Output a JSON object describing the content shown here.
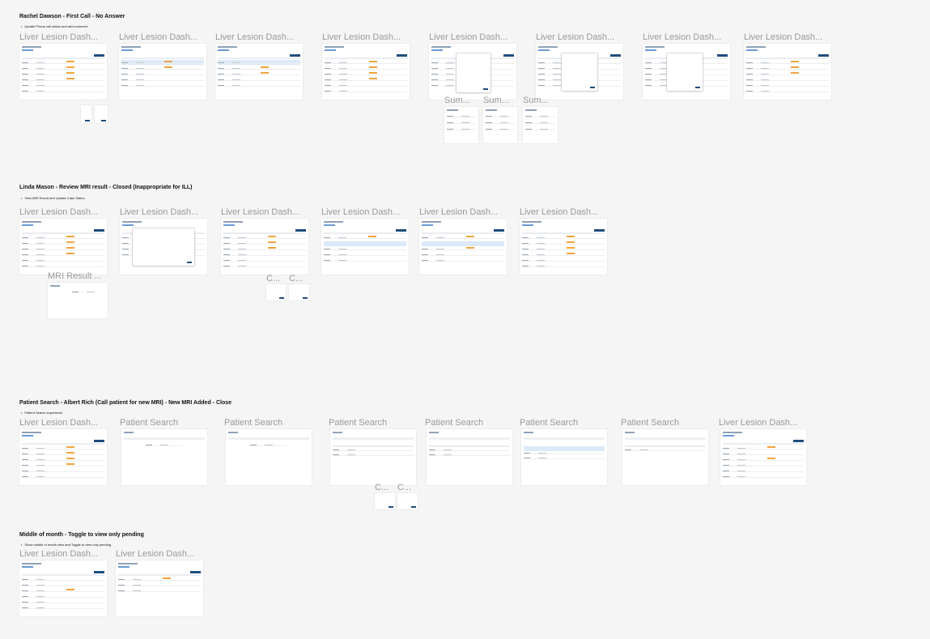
{
  "sections": [
    {
      "title": "Rachel Dawson - First Call - No Answer",
      "subtitle": "Update Phone call status and add comment",
      "frames": [
        "Liver Lesion Dash...",
        "Liver Lesion Dash...",
        "Liver Lesion Dash...",
        "Liver Lesion Dash...",
        "Liver Lesion Dash...",
        "Liver Lesion Dash...",
        "Liver Lesion Dash...",
        "Liver Lesion Dash..."
      ],
      "subframes": [
        "Sum...",
        "Sum...",
        "Sum..."
      ]
    },
    {
      "title": "Linda Mason - Review MRI result - Closed (Inappropriate for ILL)",
      "subtitle": "View MRI Result and Update Case Status",
      "frames": [
        "Liver Lesion Dash...",
        "Liver Lesion Dash...",
        "Liver Lesion Dash...",
        "Liver Lesion Dash...",
        "Liver Lesion Dash...",
        "Liver Lesion Dash..."
      ],
      "subframes": [
        "MRI Result ...",
        "C...",
        "C..."
      ]
    },
    {
      "title": "Patient Search - Albert Rich (Call patient for new MRI) - New MRI Added - Close",
      "subtitle": "Patient Search experience",
      "frames": [
        "Liver Lesion Dash...",
        "Patient Search",
        "Patient Search",
        "Patient Search",
        "Patient Search",
        "Patient Search",
        "Patient Search",
        "Liver Lesion Dash..."
      ],
      "subframes": [
        "C...",
        "C..."
      ]
    },
    {
      "title": "Middle of month - Toggle to view only pending",
      "subtitle": "Show middle of month view and Toggle to view only pending",
      "frames": [
        "Liver Lesion Dash...",
        "Liver Lesion Dash..."
      ]
    }
  ]
}
